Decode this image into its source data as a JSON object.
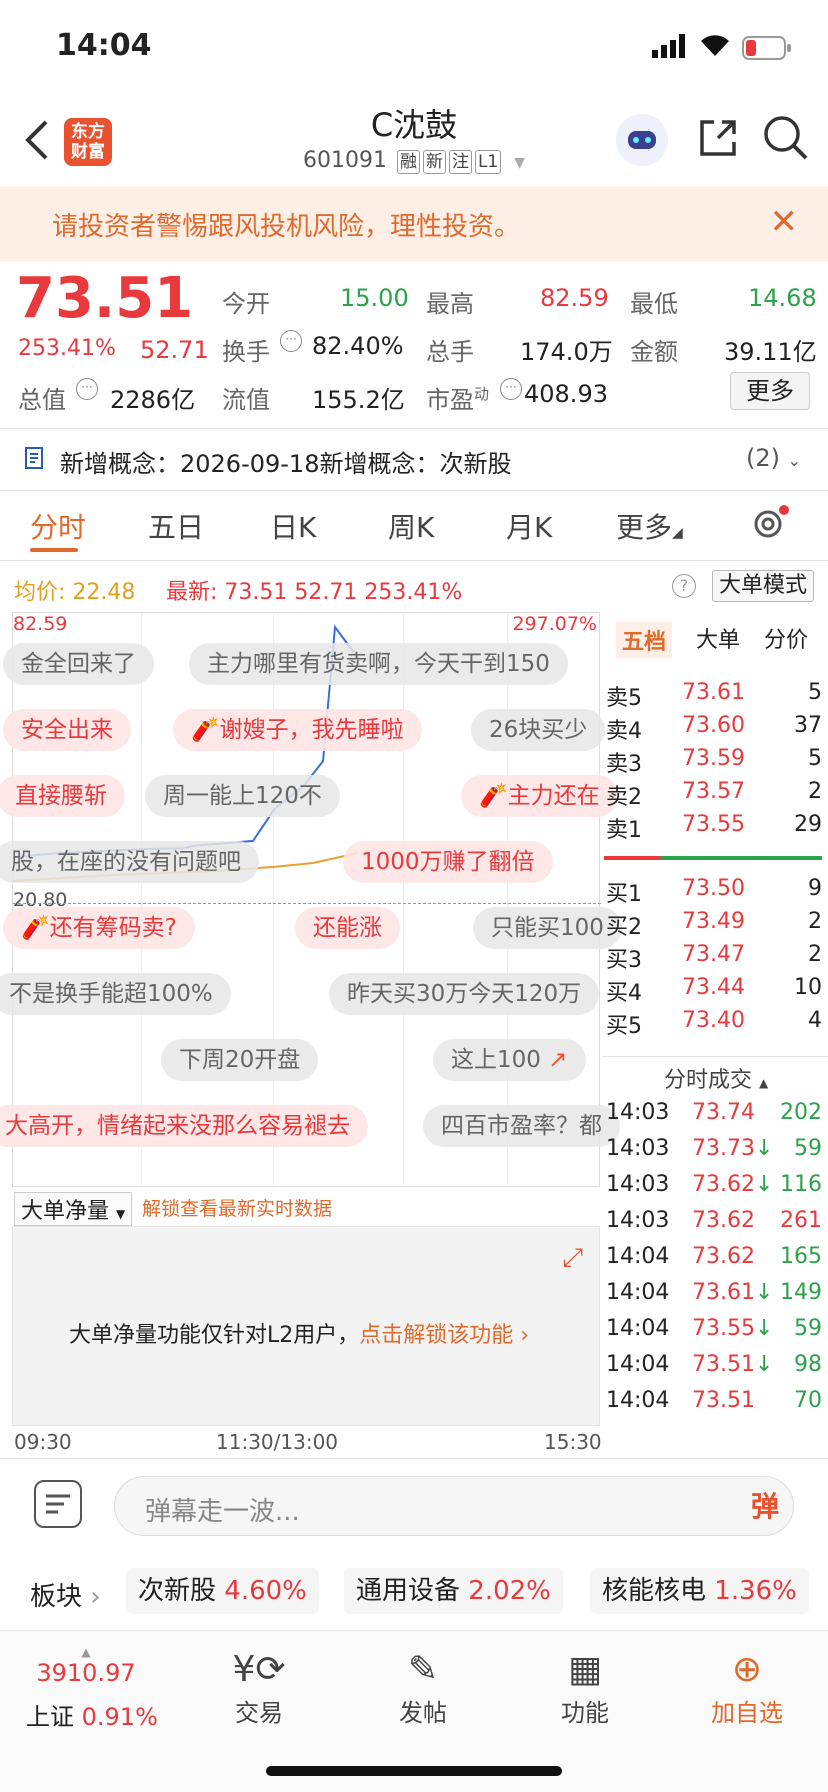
{
  "status": {
    "time": "14:04"
  },
  "header": {
    "logo_line1": "东方",
    "logo_line2": "财富",
    "title": "C沈鼓",
    "code": "601091",
    "tags": [
      "融",
      "新",
      "注",
      "L1"
    ]
  },
  "warning": {
    "text": "请投资者警惕跟风投机风险，理性投资。"
  },
  "quote": {
    "price": "73.51",
    "change_pct": "253.41%",
    "change": "52.71",
    "open_label": "今开",
    "open": "15.00",
    "high_label": "最高",
    "high": "82.59",
    "low_label": "最低",
    "low": "14.68",
    "turnover_label": "换手",
    "turnover": "82.40%",
    "volume_label": "总手",
    "volume": "174.0万",
    "amount_label": "金额",
    "amount": "39.11亿",
    "mktcap_label": "总值",
    "mktcap": "2286亿",
    "float_label": "流值",
    "float": "155.2亿",
    "pe_label": "市盈",
    "pe_sup": "动",
    "pe": "408.93",
    "more": "更多"
  },
  "concept": {
    "text": "新增概念：2026-09-18新增概念：次新股",
    "count": "(2)"
  },
  "tabs": [
    "分时",
    "五日",
    "日K",
    "周K",
    "月K",
    "更多"
  ],
  "infobar": {
    "avg_label": "均价:",
    "avg": "22.48",
    "latest_label": "最新:",
    "latest": "73.51",
    "chg": "52.71",
    "pct": "253.41%",
    "mode": "大单模式"
  },
  "chart": {
    "max_label": "82.59",
    "max_pct": "297.07%",
    "ref_label": "20.80"
  },
  "chart_data": {
    "type": "line",
    "x": [
      "09:30",
      "10:00",
      "10:30",
      "11:00",
      "11:30",
      "13:00",
      "13:30",
      "13:45",
      "13:50",
      "13:55",
      "14:00",
      "14:04"
    ],
    "series": [
      {
        "values": [
          18.5,
          19.5,
          20.2,
          20.8,
          21.0,
          21.6,
          23.0,
          32.0,
          38.0,
          45.0,
          82.0,
          73.51
        ]
      }
    ],
    "ylim": [
      14.68,
      82.59
    ]
  },
  "danmu": [
    "金全回来了",
    "主力哪里有货卖啊，今天干到150",
    "安全出来",
    "谢嫂子，我先睡啦",
    "26块买少",
    "直接腰斩",
    "周一能上120不",
    "主力还在",
    "股，在座的没有问题吧",
    "1000万赚了翻倍",
    "还有筹码卖?",
    "还能涨",
    "只能买100",
    "不是换手能超100%",
    "昨天买30万今天120万",
    "下周20开盘",
    "这上100",
    "大高开，情绪起来没那么容易褪去",
    "四百市盈率？都"
  ],
  "orderbook": {
    "tabs": [
      "五档",
      "大单",
      "分价"
    ],
    "asks": [
      {
        "label": "卖5",
        "price": "73.61",
        "vol": "5"
      },
      {
        "label": "卖4",
        "price": "73.60",
        "vol": "37"
      },
      {
        "label": "卖3",
        "price": "73.59",
        "vol": "5"
      },
      {
        "label": "卖2",
        "price": "73.57",
        "vol": "2"
      },
      {
        "label": "卖1",
        "price": "73.55",
        "vol": "29"
      }
    ],
    "bids": [
      {
        "label": "买1",
        "price": "73.50",
        "vol": "9"
      },
      {
        "label": "买2",
        "price": "73.49",
        "vol": "2"
      },
      {
        "label": "买3",
        "price": "73.47",
        "vol": "2"
      },
      {
        "label": "买4",
        "price": "73.44",
        "vol": "10"
      },
      {
        "label": "买5",
        "price": "73.40",
        "vol": "4"
      }
    ],
    "trades_title": "分时成交",
    "trades": [
      {
        "t": "14:03",
        "p": "73.74",
        "v": "202",
        "dir": ""
      },
      {
        "t": "14:03",
        "p": "73.73",
        "v": "59",
        "dir": "↓"
      },
      {
        "t": "14:03",
        "p": "73.62",
        "v": "116",
        "dir": "↓"
      },
      {
        "t": "14:03",
        "p": "73.62",
        "v": "261",
        "dir": ""
      },
      {
        "t": "14:04",
        "p": "73.62",
        "v": "165",
        "dir": ""
      },
      {
        "t": "14:04",
        "p": "73.61",
        "v": "149",
        "dir": "↓"
      },
      {
        "t": "14:04",
        "p": "73.55",
        "v": "59",
        "dir": "↓"
      },
      {
        "t": "14:04",
        "p": "73.51",
        "v": "98",
        "dir": "↓"
      },
      {
        "t": "14:04",
        "p": "73.51",
        "v": "70",
        "dir": ""
      }
    ]
  },
  "lower": {
    "select": "大单净量",
    "unlock_hint": "解锁查看最新实时数据",
    "msg": "大单净量功能仅针对L2用户，",
    "msg_link": "点击解锁该功能"
  },
  "time_axis": [
    "09:30",
    "11:30/13:00",
    "15:30"
  ],
  "comment": {
    "placeholder": "弹幕走一波...",
    "btn": "弹"
  },
  "sectors": {
    "label": "板块",
    "items": [
      {
        "name": "次新股",
        "pct": "4.60%"
      },
      {
        "name": "通用设备",
        "pct": "2.02%"
      },
      {
        "name": "核能核电",
        "pct": "1.36%"
      }
    ]
  },
  "bottom_nav": {
    "index_value": "3910.97",
    "index_name": "上证",
    "index_pct": "0.91%",
    "items": [
      "交易",
      "发帖",
      "功能",
      "加自选"
    ]
  }
}
